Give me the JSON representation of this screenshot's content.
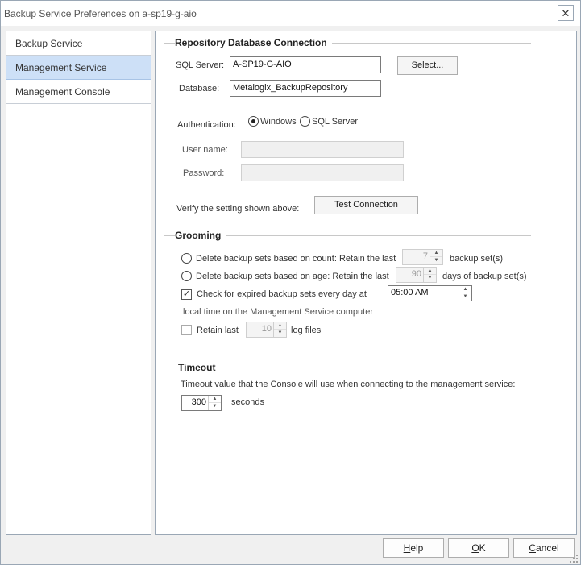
{
  "window": {
    "title": "Backup Service Preferences on a-sp19-g-aio",
    "close_glyph": "✕"
  },
  "nav": {
    "items": [
      {
        "label": "Backup Service",
        "selected": false
      },
      {
        "label": "Management Service",
        "selected": true
      },
      {
        "label": "Management Console",
        "selected": false
      }
    ]
  },
  "repository": {
    "group_title": "Repository Database Connection",
    "sql_server_label": "SQL Server:",
    "sql_server_value": "A-SP19-G-AIO",
    "select_button": "Select...",
    "database_label": "Database:",
    "database_value": "Metalogix_BackupRepository",
    "authentication_label": "Authentication:",
    "auth_windows": "Windows",
    "auth_sql": "SQL Server",
    "auth_selected": "Windows",
    "username_label": "User name:",
    "username_value": "",
    "password_label": "Password:",
    "password_value": "",
    "verify_label": "Verify the setting shown above:",
    "test_button": "Test Connection"
  },
  "grooming": {
    "group_title": "Grooming",
    "by_count_label": "Delete backup sets based on count: Retain the last",
    "by_count_value": "7",
    "by_count_suffix": "backup set(s)",
    "by_age_label": "Delete backup sets based on age: Retain the last",
    "by_age_value": "90",
    "by_age_suffix": "days of backup set(s)",
    "check_expired_label": "Check for expired backup sets every day at",
    "check_expired_checked": true,
    "check_time": "05:00 AM",
    "local_time_note": "local time on the Management Service computer",
    "retain_last_label": "Retain last",
    "retain_last_checked": false,
    "retain_last_value": "10",
    "retain_last_suffix": "log  files"
  },
  "timeout": {
    "group_title": "Timeout",
    "description": "Timeout value that the Console will use when connecting to the management service:",
    "value": "300",
    "unit": "seconds"
  },
  "buttons": {
    "help_underline": "H",
    "help_rest": "elp",
    "ok_underline": "O",
    "ok_rest": "K",
    "cancel_underline": "C",
    "cancel_rest": "ancel"
  },
  "icons": {
    "spin_up": "▲",
    "spin_down": "▼",
    "check": "✓"
  }
}
